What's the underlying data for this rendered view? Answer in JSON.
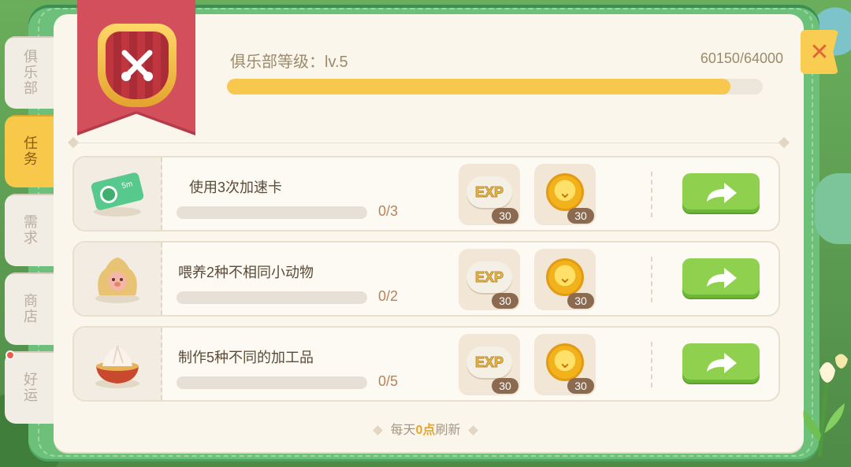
{
  "tabs": [
    {
      "label": "俱乐部",
      "active": false
    },
    {
      "label": "任务",
      "active": true
    },
    {
      "label": "需求",
      "active": false
    },
    {
      "label": "商店",
      "active": false
    },
    {
      "label": "好运",
      "active": false,
      "has_dot": true
    }
  ],
  "club": {
    "level_label": "俱乐部等级：lv.5",
    "progress_text": "60150/64000",
    "progress_fraction": 0.9399
  },
  "close_icon": "close-icon",
  "tasks": [
    {
      "icon": "speedup-card-icon",
      "title": "使用3次加速卡",
      "progress": "0/3",
      "exp_reward": "30",
      "coin_reward": "30"
    },
    {
      "icon": "animal-feed-sack-icon",
      "title": "喂养2种不相同小动物",
      "progress": "0/2",
      "exp_reward": "30",
      "coin_reward": "30"
    },
    {
      "icon": "processed-food-bowl-icon",
      "title": "制作5种不同的加工品",
      "progress": "0/5",
      "exp_reward": "30",
      "coin_reward": "30"
    }
  ],
  "exp_label": "EXP",
  "footer": {
    "prefix": "每天",
    "number": "0点",
    "suffix": "刷新"
  },
  "colors": {
    "accent": "#f8c74e",
    "banner": "#d44f5c",
    "go_button": "#8fd14f",
    "panel": "#fbf6ec"
  }
}
